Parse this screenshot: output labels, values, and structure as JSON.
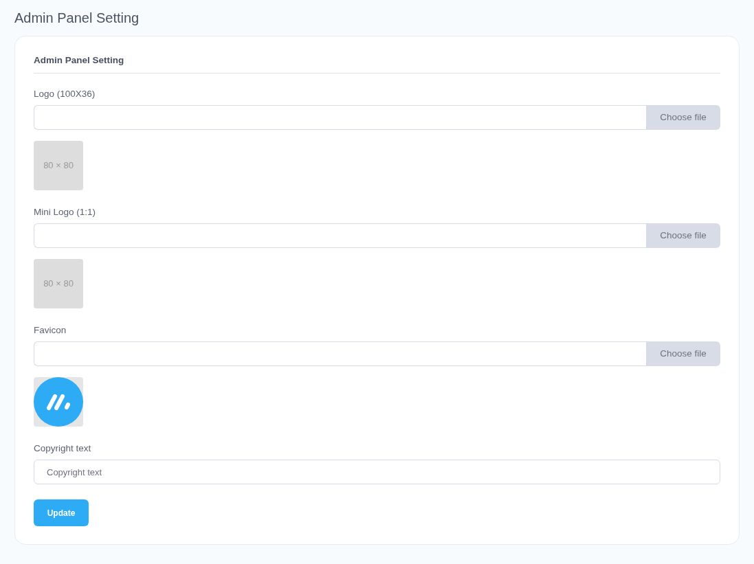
{
  "page_title": "Admin Panel Setting",
  "card": {
    "title": "Admin Panel Setting",
    "fields": [
      {
        "kind": "file",
        "label": "Logo (100X36)",
        "button": "Choose file",
        "preview": {
          "kind": "placeholder",
          "text": "80 × 80"
        }
      },
      {
        "kind": "file",
        "label": "Mini Logo (1:1)",
        "button": "Choose file",
        "preview": {
          "kind": "placeholder",
          "text": "80 × 80"
        }
      },
      {
        "kind": "file",
        "label": "Favicon",
        "button": "Choose file",
        "preview": {
          "kind": "logo"
        }
      },
      {
        "kind": "text",
        "label": "Copyright text",
        "placeholder": "Copyright text"
      }
    ],
    "submit": "Update"
  }
}
